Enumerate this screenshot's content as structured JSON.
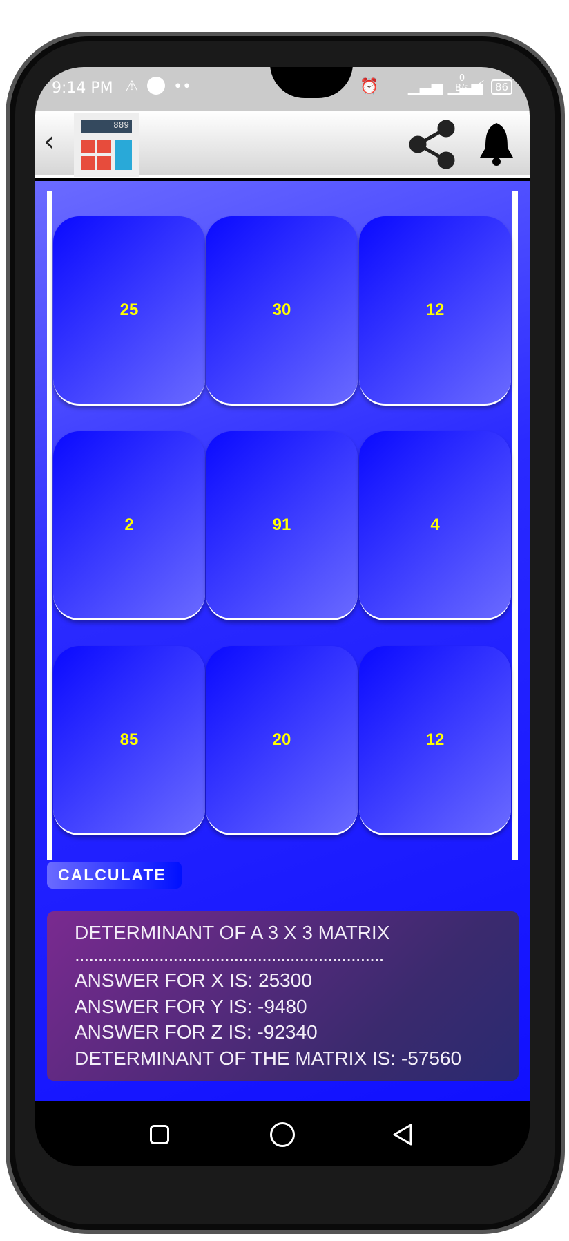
{
  "status_bar": {
    "time": "9:14 PM",
    "net_speed": "0 B/s",
    "battery": "86"
  },
  "header": {
    "logo_display": "889"
  },
  "matrix": [
    [
      "25",
      "30",
      "12"
    ],
    [
      "2",
      "91",
      "4"
    ],
    [
      "85",
      "20",
      "12"
    ]
  ],
  "calculate_label": "CALCULATE",
  "result": {
    "title": "DETERMINANT OF A 3 X 3 MATRIX",
    "separator": "..................................................................",
    "x": "ANSWER FOR X IS: 25300",
    "y": "ANSWER FOR Y IS: -9480",
    "z": "ANSWER FOR Z IS: -92340",
    "det": "DETERMINANT OF THE MATRIX IS: -57560"
  },
  "colors": {
    "cell_text": "#ffff00",
    "background": "#1010ff"
  }
}
